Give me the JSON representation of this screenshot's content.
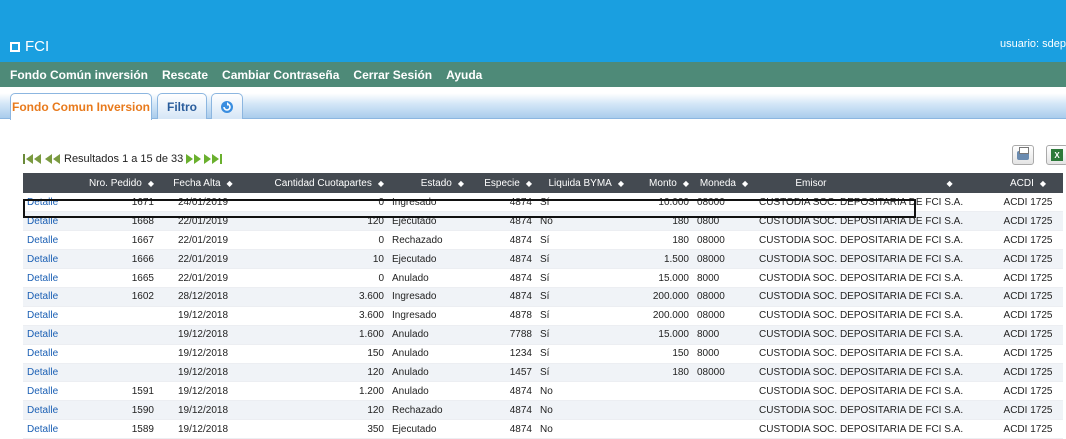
{
  "header": {
    "app_title": "FCI",
    "user_label": "usuario: sdep"
  },
  "menu": [
    "Fondo Común inversión",
    "Rescate",
    "Cambiar Contraseña",
    "Cerrar Sesión",
    "Ayuda"
  ],
  "tabs": {
    "main": "Fondo Comun Inversion",
    "filter": "Filtro",
    "refresh_icon": "refresh-icon"
  },
  "pager": {
    "text": "Resultados 1 a 15  de 33"
  },
  "toolbar": {
    "print_icon": "printer-icon",
    "excel_icon": "excel-icon",
    "excel_glyph": "X"
  },
  "table": {
    "columns": [
      "",
      "Nro. Pedido",
      "Fecha Alta",
      "Cantidad Cuotapartes",
      "Estado",
      "Especie",
      "Liquida BYMA",
      "Monto",
      "Moneda",
      "Emisor",
      "ACDI"
    ],
    "rows": [
      {
        "link": "Detalle",
        "pedido": "1671",
        "fecha": "24/01/2019",
        "cantidad": "0",
        "estado": "Ingresado",
        "especie": "4874",
        "byma": "Sí",
        "monto": "10.000",
        "moneda": "08000",
        "emisor": "CUSTODIA SOC. DEPOSITARIA DE FCI S.A.",
        "acdi": "ACDI 1725"
      },
      {
        "link": "Detalle",
        "pedido": "1668",
        "fecha": "22/01/2019",
        "cantidad": "120",
        "estado": "Ejecutado",
        "especie": "4874",
        "byma": "No",
        "monto": "180",
        "moneda": "0800",
        "emisor": "CUSTODIA SOC. DEPOSITARIA DE FCI S.A.",
        "acdi": "ACDI 1725"
      },
      {
        "link": "Detalle",
        "pedido": "1667",
        "fecha": "22/01/2019",
        "cantidad": "0",
        "estado": "Rechazado",
        "especie": "4874",
        "byma": "Sí",
        "monto": "180",
        "moneda": "08000",
        "emisor": "CUSTODIA SOC. DEPOSITARIA DE FCI S.A.",
        "acdi": "ACDI 1725"
      },
      {
        "link": "Detalle",
        "pedido": "1666",
        "fecha": "22/01/2019",
        "cantidad": "10",
        "estado": "Ejecutado",
        "especie": "4874",
        "byma": "Sí",
        "monto": "1.500",
        "moneda": "08000",
        "emisor": "CUSTODIA SOC. DEPOSITARIA DE FCI S.A.",
        "acdi": "ACDI 1725"
      },
      {
        "link": "Detalle",
        "pedido": "1665",
        "fecha": "22/01/2019",
        "cantidad": "0",
        "estado": "Anulado",
        "especie": "4874",
        "byma": "Sí",
        "monto": "15.000",
        "moneda": "8000",
        "emisor": "CUSTODIA SOC. DEPOSITARIA DE FCI S.A.",
        "acdi": "ACDI 1725"
      },
      {
        "link": "Detalle",
        "pedido": "1602",
        "fecha": "28/12/2018",
        "cantidad": "3.600",
        "estado": "Ingresado",
        "especie": "4874",
        "byma": "Sí",
        "monto": "200.000",
        "moneda": "08000",
        "emisor": "CUSTODIA SOC. DEPOSITARIA DE FCI S.A.",
        "acdi": "ACDI 1725"
      },
      {
        "link": "Detalle",
        "pedido": "",
        "fecha": "19/12/2018",
        "cantidad": "3.600",
        "estado": "Ingresado",
        "especie": "4878",
        "byma": "Sí",
        "monto": "200.000",
        "moneda": "08000",
        "emisor": "CUSTODIA SOC. DEPOSITARIA DE FCI S.A.",
        "acdi": "ACDI 1725"
      },
      {
        "link": "Detalle",
        "pedido": "",
        "fecha": "19/12/2018",
        "cantidad": "1.600",
        "estado": "Anulado",
        "especie": "7788",
        "byma": "Sí",
        "monto": "15.000",
        "moneda": "8000",
        "emisor": "CUSTODIA SOC. DEPOSITARIA DE FCI S.A.",
        "acdi": "ACDI 1725"
      },
      {
        "link": "Detalle",
        "pedido": "",
        "fecha": "19/12/2018",
        "cantidad": "150",
        "estado": "Anulado",
        "especie": "1234",
        "byma": "Sí",
        "monto": "150",
        "moneda": "8000",
        "emisor": "CUSTODIA SOC. DEPOSITARIA DE FCI S.A.",
        "acdi": "ACDI 1725"
      },
      {
        "link": "Detalle",
        "pedido": "",
        "fecha": "19/12/2018",
        "cantidad": "120",
        "estado": "Anulado",
        "especie": "1457",
        "byma": "Sí",
        "monto": "180",
        "moneda": "08000",
        "emisor": "CUSTODIA SOC. DEPOSITARIA DE FCI S.A.",
        "acdi": "ACDI 1725"
      },
      {
        "link": "Detalle",
        "pedido": "1591",
        "fecha": "19/12/2018",
        "cantidad": "1.200",
        "estado": "Anulado",
        "especie": "4874",
        "byma": "No",
        "monto": "",
        "moneda": "",
        "emisor": "CUSTODIA SOC. DEPOSITARIA DE FCI S.A.",
        "acdi": "ACDI 1725"
      },
      {
        "link": "Detalle",
        "pedido": "1590",
        "fecha": "19/12/2018",
        "cantidad": "120",
        "estado": "Rechazado",
        "especie": "4874",
        "byma": "No",
        "monto": "",
        "moneda": "",
        "emisor": "CUSTODIA SOC. DEPOSITARIA DE FCI S.A.",
        "acdi": "ACDI 1725"
      },
      {
        "link": "Detalle",
        "pedido": "1589",
        "fecha": "19/12/2018",
        "cantidad": "350",
        "estado": "Ejecutado",
        "especie": "4874",
        "byma": "No",
        "monto": "",
        "moneda": "",
        "emisor": "CUSTODIA SOC. DEPOSITARIA DE FCI S.A.",
        "acdi": "ACDI 1725"
      }
    ]
  }
}
